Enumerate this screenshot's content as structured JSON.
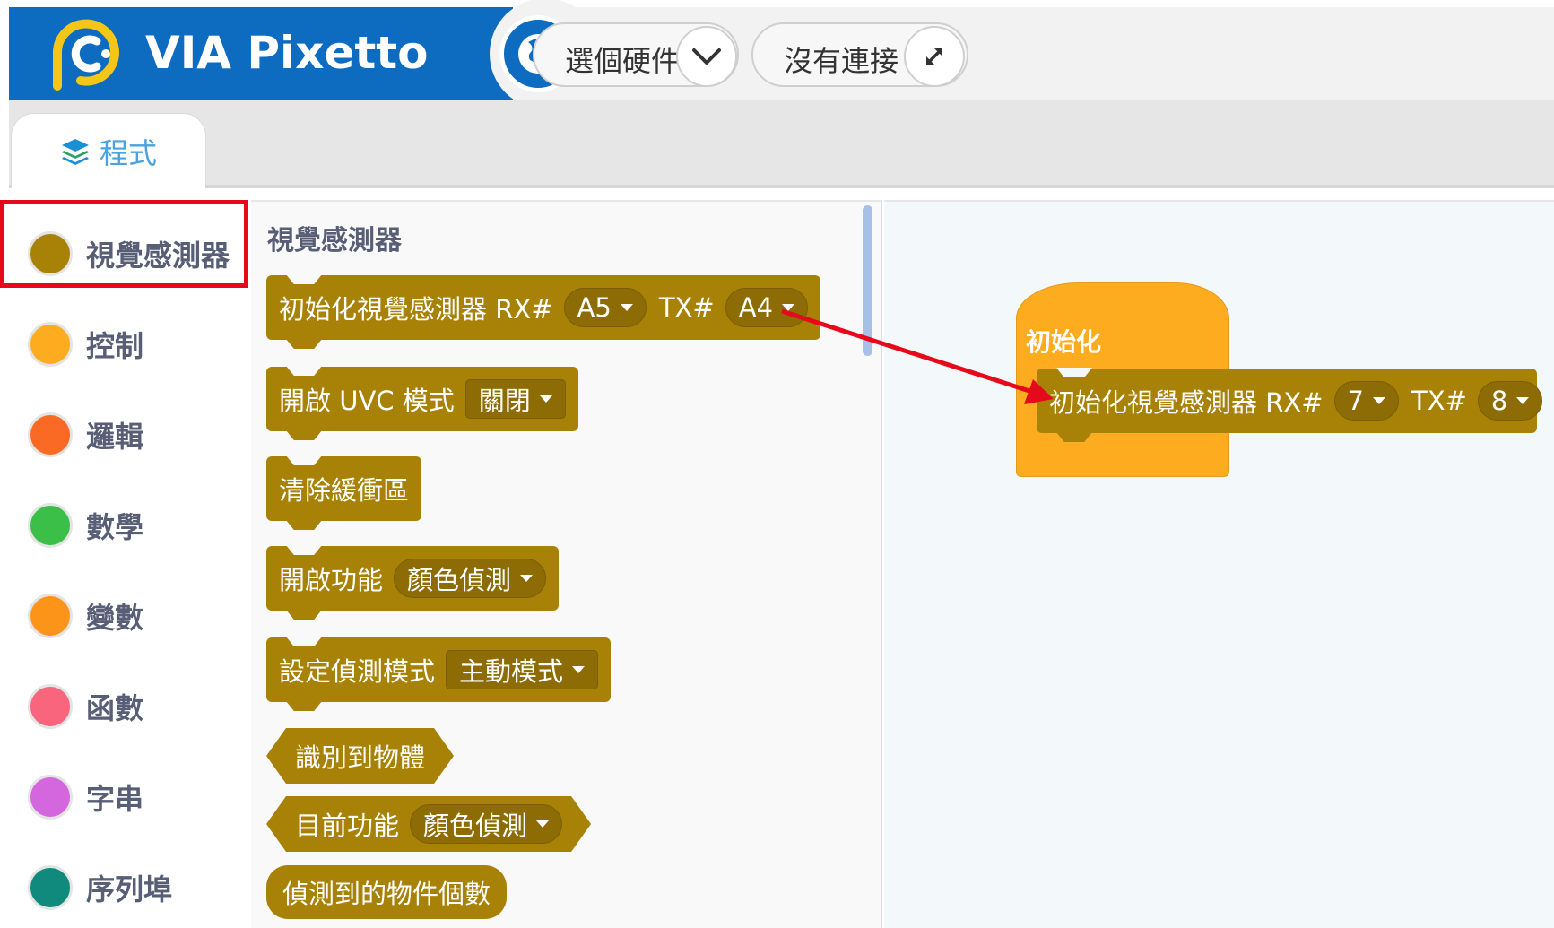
{
  "header": {
    "brand": "VIA Pixetto",
    "hardware_select_label": "選個硬件",
    "connection_label": "沒有連接",
    "brand_color": "#0d6bc0",
    "icons": [
      "pixetto-logo-icon",
      "globe-icon",
      "chevron-down-icon",
      "expand-icon"
    ]
  },
  "tabs": [
    {
      "label": "程式",
      "icon": "layers-icon"
    }
  ],
  "categories": [
    {
      "label": "視覺感測器",
      "color": "#a88206"
    },
    {
      "label": "控制",
      "color": "#fdab1f"
    },
    {
      "label": "邏輯",
      "color": "#fb6a24"
    },
    {
      "label": "數學",
      "color": "#3cbf49"
    },
    {
      "label": "變數",
      "color": "#fb9418"
    },
    {
      "label": "函數",
      "color": "#f8657c"
    },
    {
      "label": "字串",
      "color": "#d466de"
    },
    {
      "label": "序列埠",
      "color": "#108a7d"
    }
  ],
  "flyout": {
    "title": "視覺感測器",
    "blocks": [
      {
        "text": "初始化視覺感測器 RX#",
        "rx": "A5",
        "tx_label": "TX#",
        "tx": "A4"
      },
      {
        "text": "開啟 UVC 模式",
        "value": "關閉"
      },
      {
        "text": "清除緩衝區"
      },
      {
        "text": "開啟功能",
        "value": "顏色偵測"
      },
      {
        "text": "設定偵測模式",
        "value": "主動模式"
      },
      {
        "text": "識別到物體"
      },
      {
        "text": "目前功能",
        "value": "顏色偵測"
      },
      {
        "text": "偵測到的物件個數"
      }
    ]
  },
  "workspace": {
    "hat_label": "初始化",
    "init_block": {
      "text": "初始化視覺感測器 RX#",
      "rx": "7",
      "tx_label": "TX#",
      "tx": "8"
    }
  },
  "colors": {
    "sensor_block": "#a88206",
    "control_block": "#fdab1f",
    "highlight": "#e5091b",
    "workspace_bg": "#f3f8fb"
  }
}
